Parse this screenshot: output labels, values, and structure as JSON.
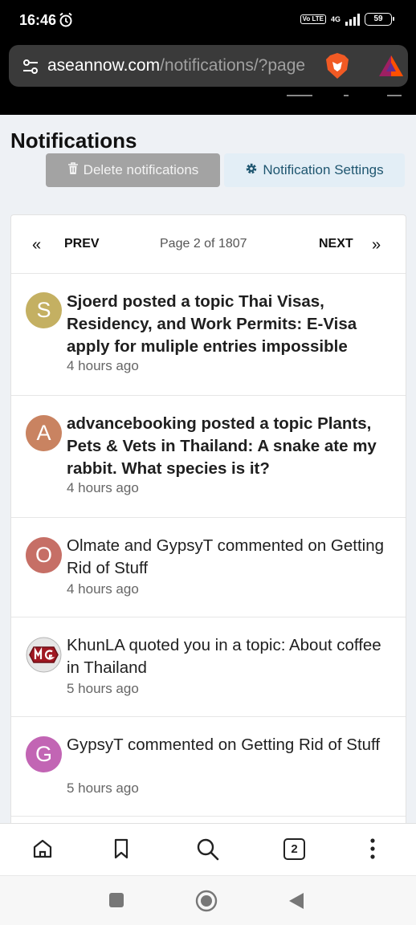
{
  "status_bar": {
    "time": "16:46",
    "volte": "Vo LTE",
    "network": "4G",
    "battery": "59"
  },
  "browser": {
    "url_domain": "aseannow.com",
    "url_path": "/notifications/?page"
  },
  "page": {
    "title": "Notifications",
    "delete_label": "Delete notifications",
    "settings_label": "Notification Settings"
  },
  "pager": {
    "prev_label": "PREV",
    "page_info": "Page 2 of 1807",
    "next_label": "NEXT"
  },
  "notifications": [
    {
      "avatar_letter": "S",
      "avatar_color": "#c4b062",
      "text": "Sjoerd posted a topic Thai Visas, Residency, and Work Permits: E-Visa apply for muliple entries impossible",
      "time": "4 hours ago",
      "unread": true
    },
    {
      "avatar_letter": "A",
      "avatar_color": "#c98361",
      "text": "advancebooking posted a topic Plants, Pets & Vets in Thailand: A snake ate my rabbit. What species is it?",
      "time": "4 hours ago",
      "unread": true
    },
    {
      "avatar_letter": "O",
      "avatar_color": "#c66f66",
      "text": "Olmate and GypsyT commented on Getting Rid of Stuff",
      "time": "4 hours ago",
      "unread": false
    },
    {
      "avatar_letter": "MG",
      "avatar_color": "#a01822",
      "text": "KhunLA quoted you in a topic: About coffee in Thailand",
      "time": "5 hours ago",
      "unread": false
    },
    {
      "avatar_letter": "G",
      "avatar_color": "#c265b4",
      "text": "GypsyT commented on Getting Rid of Stuff",
      "time": "5 hours ago",
      "unread": false
    }
  ],
  "bottom_nav": {
    "tabs_count": "2",
    "icons": [
      "home-icon",
      "bookmark-icon",
      "search-icon",
      "tabs-icon",
      "more-menu-icon"
    ]
  },
  "colors": {
    "page_bg": "#eef1f5",
    "settings_text": "#1f5670",
    "delete_bg": "#a3a3a3"
  }
}
